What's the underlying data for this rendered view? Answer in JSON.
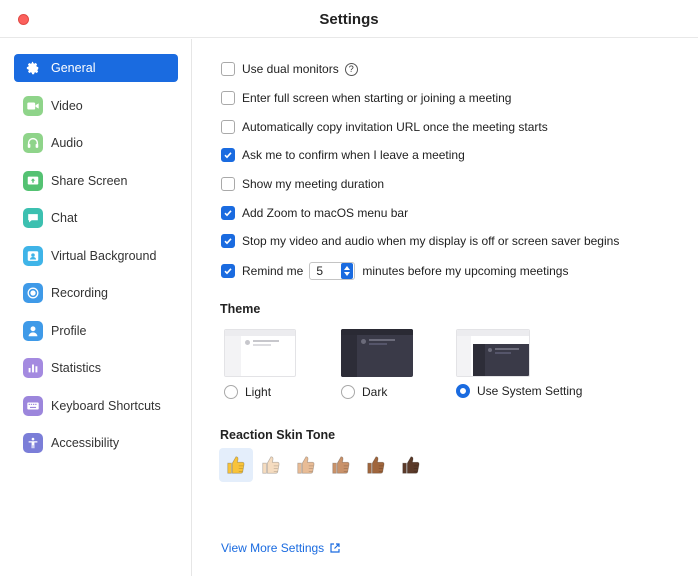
{
  "window": {
    "title": "Settings"
  },
  "sidebar": {
    "items": [
      {
        "label": "General",
        "icon": "gear-icon",
        "color": "#1a6be0",
        "active": true
      },
      {
        "label": "Video",
        "icon": "video-camera-icon",
        "color": "#3dbd5c"
      },
      {
        "label": "Audio",
        "icon": "headphones-icon",
        "color": "#3dbd5c"
      },
      {
        "label": "Share Screen",
        "icon": "share-screen-icon",
        "color": "#3dbd5c"
      },
      {
        "label": "Chat",
        "icon": "chat-bubble-icon",
        "color": "#29b3a7"
      },
      {
        "label": "Virtual Background",
        "icon": "person-background-icon",
        "color": "#2fa8e0"
      },
      {
        "label": "Recording",
        "icon": "record-icon",
        "color": "#2f8de4"
      },
      {
        "label": "Profile",
        "icon": "person-icon",
        "color": "#2f8de4"
      },
      {
        "label": "Statistics",
        "icon": "bar-chart-icon",
        "color": "#8a6ad6"
      },
      {
        "label": "Keyboard Shortcuts",
        "icon": "keyboard-icon",
        "color": "#8a6ad6"
      },
      {
        "label": "Accessibility",
        "icon": "accessibility-icon",
        "color": "#6b6ed8"
      }
    ]
  },
  "general": {
    "options": [
      {
        "label": "Use dual monitors",
        "checked": false,
        "help": "?"
      },
      {
        "label": "Enter full screen when starting or joining a meeting",
        "checked": false
      },
      {
        "label": "Automatically copy invitation URL once the meeting starts",
        "checked": false
      },
      {
        "label": "Ask me to confirm when I leave a meeting",
        "checked": true
      },
      {
        "label": "Show my meeting duration",
        "checked": false
      },
      {
        "label": "Add Zoom to macOS menu bar",
        "checked": true
      },
      {
        "label": "Stop my video and audio when my display is off or screen saver begins",
        "checked": true
      }
    ],
    "remind": {
      "checked": true,
      "prefix": "Remind me",
      "value": "5",
      "suffix": "minutes before my upcoming meetings"
    },
    "theme": {
      "title": "Theme",
      "options": [
        {
          "label": "Light",
          "selected": false
        },
        {
          "label": "Dark",
          "selected": false
        },
        {
          "label": "Use System Setting",
          "selected": true
        }
      ]
    },
    "skin_tone": {
      "title": "Reaction Skin Tone",
      "tones": [
        "#f8c33a",
        "#f5dcc0",
        "#e8bc96",
        "#c9926a",
        "#a0663d",
        "#5b3a29"
      ],
      "selected_index": 0
    },
    "more_link": "View More Settings"
  },
  "colors": {
    "accent": "#1a6be0",
    "close": "#fc605c"
  }
}
